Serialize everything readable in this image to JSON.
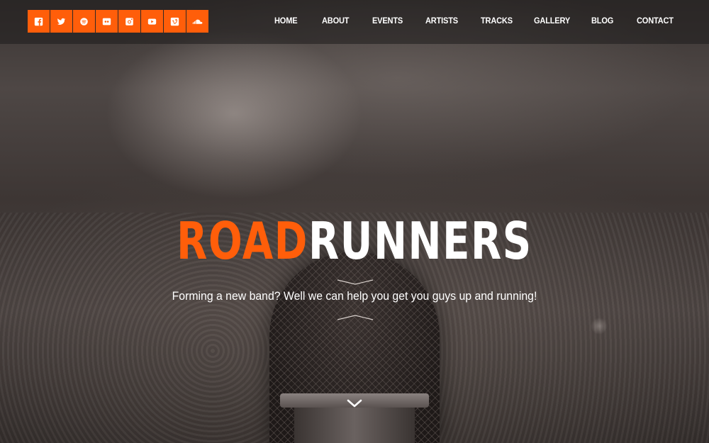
{
  "brand": {
    "title_part1": "ROAD",
    "title_part2": "RUNNERS",
    "accent_color": "#ff5e0a",
    "tagline": "Forming a new band? Well we can help you get you guys up and running!"
  },
  "social": [
    {
      "name": "facebook",
      "icon": "facebook-icon"
    },
    {
      "name": "twitter",
      "icon": "twitter-icon"
    },
    {
      "name": "spotify",
      "icon": "spotify-icon"
    },
    {
      "name": "flickr",
      "icon": "flickr-icon"
    },
    {
      "name": "instagram",
      "icon": "instagram-icon"
    },
    {
      "name": "youtube",
      "icon": "youtube-icon"
    },
    {
      "name": "vimeo",
      "icon": "vimeo-icon"
    },
    {
      "name": "soundcloud",
      "icon": "soundcloud-icon"
    }
  ],
  "nav": [
    {
      "label": "HOME"
    },
    {
      "label": "ABOUT"
    },
    {
      "label": "EVENTS"
    },
    {
      "label": "ARTISTS"
    },
    {
      "label": "TRACKS"
    },
    {
      "label": "GALLERY"
    },
    {
      "label": "BLOG"
    },
    {
      "label": "CONTACT"
    }
  ],
  "scroll_icon": "chevron-down-icon"
}
